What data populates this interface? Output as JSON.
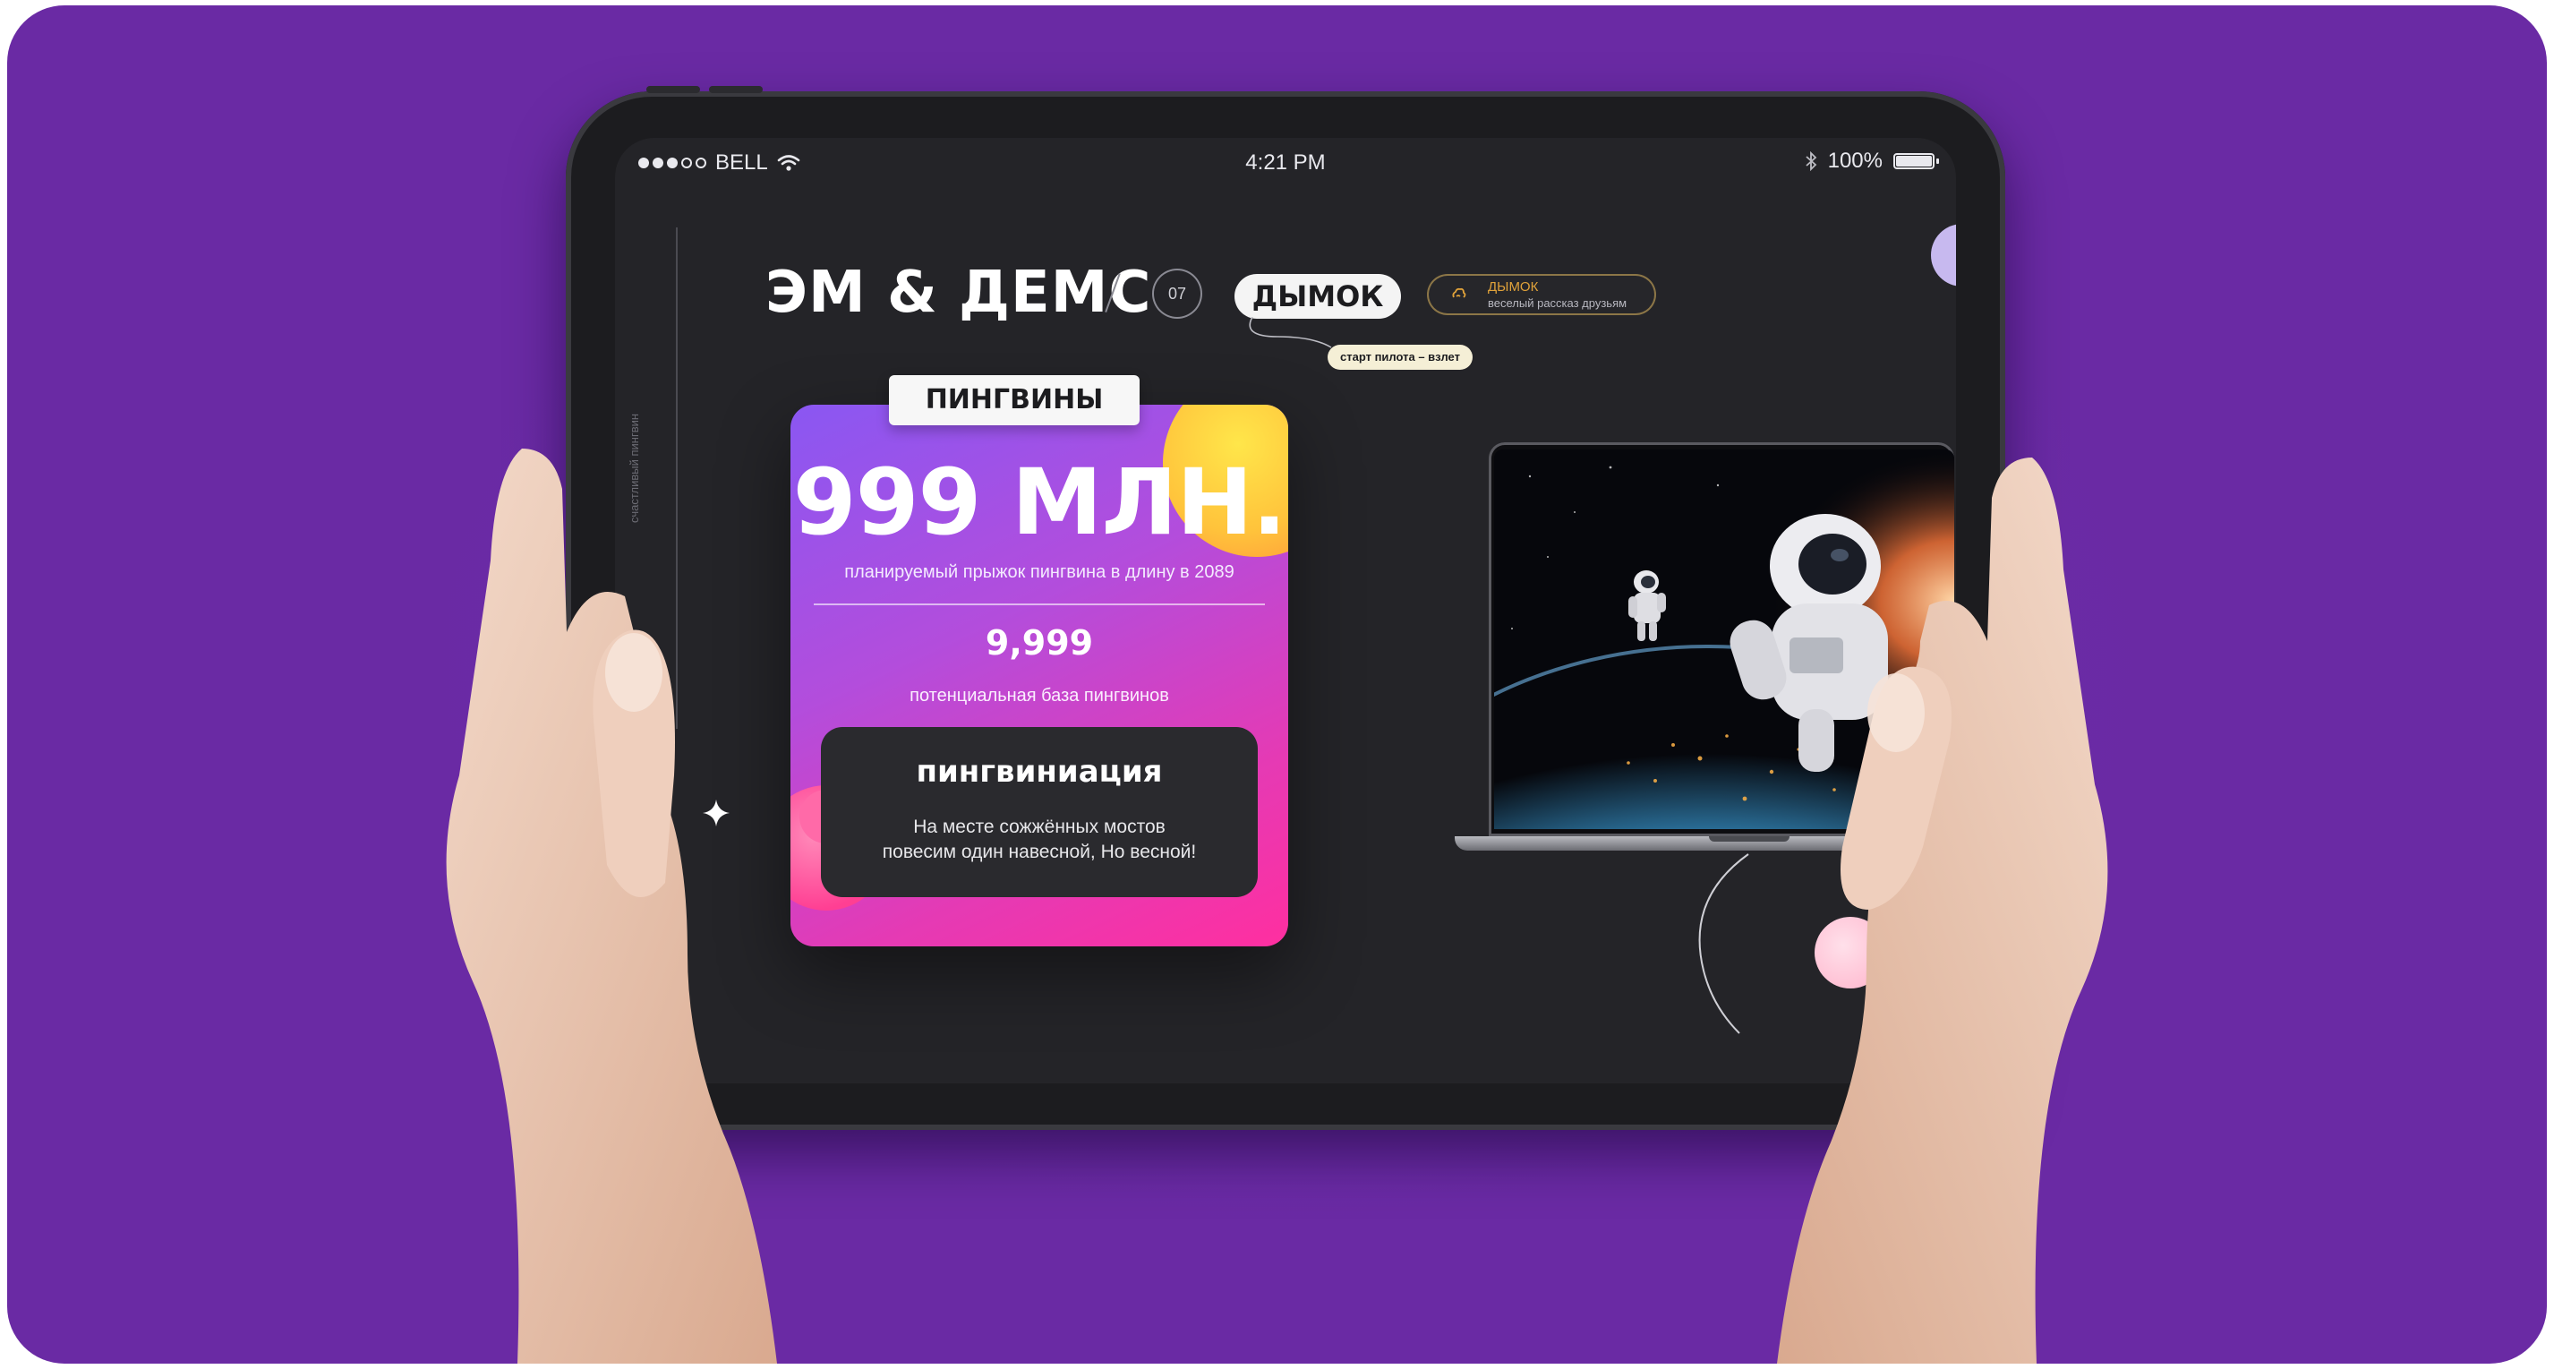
{
  "statusbar": {
    "carrier": "BELL",
    "time": "4:21 PM",
    "battery_text": "100%"
  },
  "app": {
    "brand": "ЭМ & ДЕМС",
    "slide_number": "07",
    "pill_primary": "ДЫМОК",
    "pill_secondary_title": "ДЫМОК",
    "pill_secondary_sub": "веселый рассказ друзьям",
    "note_tag": "старт пилота – взлет",
    "rail_label": "счастливый пингвин"
  },
  "card": {
    "tab_label": "ПИНГВИНЫ",
    "big_value": "999 МЛН.",
    "big_caption": "планируемый прыжок пингвина в длину в 2089",
    "mid_value": "9,999",
    "mid_caption": "потенциальная база пингвинов",
    "box_title": "пингвиниация",
    "box_line1": "На месте сожжённых мостов",
    "box_line2": "повесим один навесной, Но весной!"
  },
  "colors": {
    "background": "#6a2aa4",
    "screen": "#242428",
    "card_gradient_start": "#8a57f2",
    "card_gradient_end": "#ff2fa0",
    "accent_yellow": "#ffd23f",
    "accent_orange_text": "#e0a23a"
  },
  "icons": [
    "wifi-icon",
    "bluetooth-icon",
    "battery-icon",
    "signal-dots-icon",
    "smoke-icon",
    "sparkle-icon"
  ]
}
